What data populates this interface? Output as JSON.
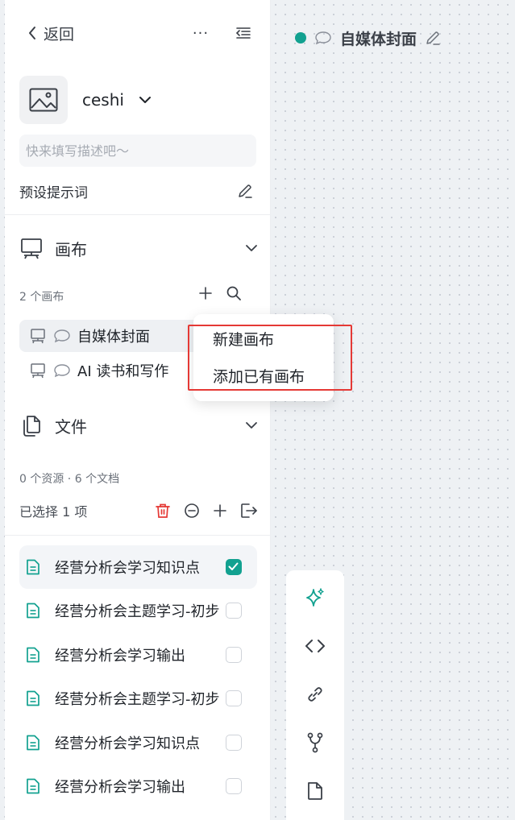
{
  "header": {
    "back_label": "返回",
    "more_label": "···"
  },
  "project": {
    "name": "ceshi",
    "description_placeholder": "快来填写描述吧～",
    "preset_label": "预设提示词"
  },
  "canvas_section": {
    "title": "画布",
    "count_label": "2 个画布",
    "items": [
      {
        "label": "自媒体封面"
      },
      {
        "label": "AI 读书和写作"
      }
    ]
  },
  "dropdown": {
    "items": [
      "新建画布",
      "添加已有画布"
    ]
  },
  "files_section": {
    "title": "文件",
    "count_label": "0 个资源 · 6 个文档",
    "selected_label": "已选择 1 项",
    "items": [
      {
        "label": "经营分析会学习知识点",
        "checked": true
      },
      {
        "label": "经营分析会主题学习-初步",
        "checked": false
      },
      {
        "label": "经营分析会学习输出",
        "checked": false
      },
      {
        "label": "经营分析会主题学习-初步",
        "checked": false
      },
      {
        "label": "经营分析会学习知识点",
        "checked": false
      },
      {
        "label": "经营分析会学习输出",
        "checked": false
      }
    ]
  },
  "canvas": {
    "title": "自媒体封面"
  },
  "toolbar": {
    "icons": [
      "sparkle-icon",
      "code-icon",
      "link-icon",
      "branch-icon",
      "document-icon"
    ]
  },
  "colors": {
    "accent": "#12a190",
    "danger": "#e53935",
    "highlight_border": "#e53935"
  }
}
